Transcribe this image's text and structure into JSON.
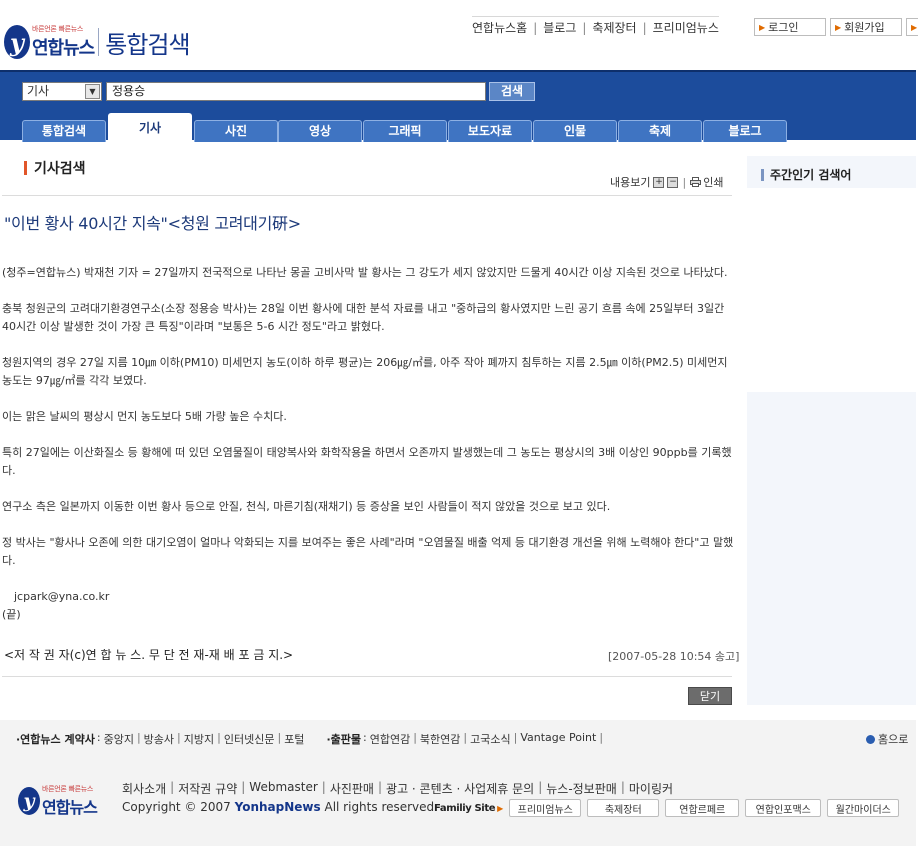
{
  "header": {
    "logo_slogan": "바른언론 빠른뉴스",
    "logo_name": "연합뉴스",
    "service_title": "통합검색",
    "top_links": [
      "연합뉴스홈",
      "블로그",
      "축제장터",
      "프리미엄뉴스"
    ],
    "login_label": "로그인",
    "join_label": "회원가입"
  },
  "search": {
    "category": "기사",
    "query": "정용승",
    "button_label": "검색"
  },
  "tabs": [
    "통합검색",
    "기사",
    "사진",
    "영상",
    "그래픽",
    "보도자료",
    "인물",
    "축제",
    "블로그"
  ],
  "active_tab": "기사",
  "main": {
    "section_title": "기사검색",
    "view_label": "내용보기",
    "plus_icon": "+",
    "minus_icon": "−",
    "print_label": "인쇄",
    "headline": "\"이번 황사 40시간 지속\"<청원 고려대기硏>",
    "paragraphs": [
      "(청주=연합뉴스) 박재천 기자 = 27일까지 전국적으로 나타난 몽골 고비사막 발 황사는 그 강도가 세지 않았지만 드물게 40시간 이상 지속된 것으로 나타났다.",
      "  충북 청원군의 고려대기환경연구소(소장 정용승 박사)는 28일 이번 황사에 대한 분석 자료를 내고 \"중하급의 황사였지만 느린 공기 흐름 속에 25일부터 3일간 40시간 이상 발생한 것이 가장 큰 특징\"이라며 \"보통은 5-6 시간 정도\"라고 밝혔다.",
      "  청원지역의 경우 27일 지름 10㎛ 이하(PM10) 미세먼지 농도(이하 하루 평균)는 206㎍/㎥를, 아주 작아 폐까지 침투하는 지름 2.5㎛ 이하(PM2.5) 미세먼지 농도는 97㎍/㎥를 각각 보였다.",
      "  이는 맑은 날씨의 평상시 먼지 농도보다 5배 가량 높은 수치다.",
      "  특히 27일에는 이산화질소 등 황해에 떠 있던 오염물질이 태양복사와 화학작용을 하면서 오존까지 발생했는데 그 농도는 평상시의 3배 이상인 90ppb를 기록했다.",
      "  연구소 측은 일본까지 이동한 이번 황사 등으로 안질, 천식, 마른기침(재채기) 등 증상을 보인 사람들이 적지 않았을 것으로 보고 있다.",
      "  정 박사는 \"황사나 오존에 의한 대기오염이 얼마나 악화되는 지를 보여주는 좋은 사례\"라며 \"오염물질 배출 억제 등 대기환경 개선을 위해 노력해야 한다\"고 말했다."
    ],
    "email": "jcpark@yna.co.kr",
    "end_mark": "(끝)",
    "copyright": "<저 작 권 자(c)연 합 뉴 스. 무 단 전 재-재 배 포 금 지.>",
    "pubdate": "[2007-05-28 10:54 송고]",
    "close_label": "닫기"
  },
  "sidebar": {
    "title": "주간인기 검색어"
  },
  "footer": {
    "contract_label": "·연합뉴스 계약사",
    "contract_items": [
      "중앙지",
      "방송사",
      "지방지",
      "인터넷신문",
      "포털"
    ],
    "publication_label": "·출판물",
    "publication_items": [
      "연합연감",
      "북한연감",
      "고국소식",
      "Vantage Point"
    ],
    "home_label": "홈으로",
    "links": [
      "회사소개",
      "저작권 규약",
      "Webmaster",
      "사진판매",
      "광고 · 콘텐츠 · 사업제휴 문의",
      "뉴스-정보판매",
      "마이링커"
    ],
    "copyright_prefix": "Copyright © 2007",
    "copyright_brand": "YonhapNews",
    "copyright_suffix": "All rights reserved.",
    "family_label": "Familiy Site",
    "family_sites": [
      "프리미엄뉴스",
      "축제장터",
      "연합르페르",
      "연합인포맥스",
      "월간마이더스"
    ]
  }
}
